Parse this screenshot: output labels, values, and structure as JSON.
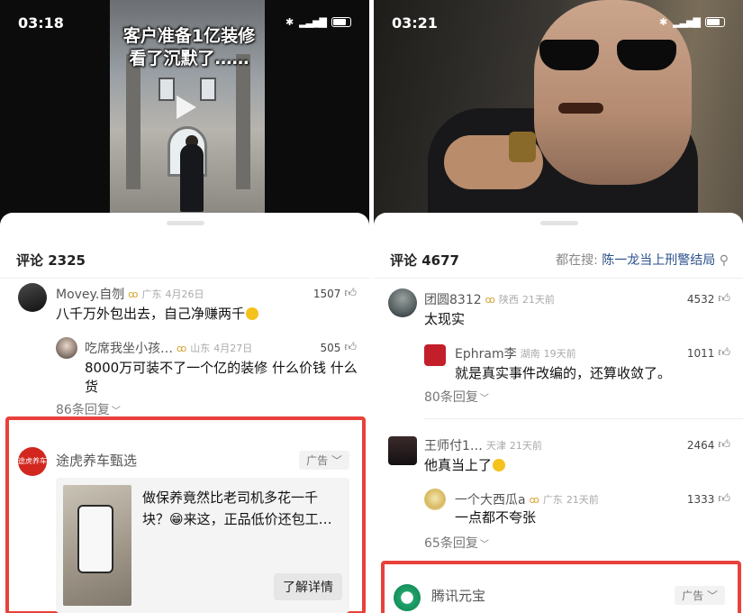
{
  "left": {
    "status_time": "03:18",
    "video_caption_line1": "客户准备1亿装修",
    "video_caption_line2": "看了沉默了……",
    "comment_count": "评论 2325",
    "comments": [
      {
        "name": "Movey.自刎",
        "location": "广东",
        "date": "4月26日",
        "likes": "1507",
        "text": "八千万外包出去，自己净赚两千"
      },
      {
        "name": "吃席我坐小孩…",
        "location": "山东",
        "date": "4月27日",
        "likes": "505",
        "text_line1": "8000万可装不了一个亿的装修 什么价钱 什么",
        "text_line2": "货"
      }
    ],
    "replies_link": "86条回复",
    "ad": {
      "name": "途虎养车甄选",
      "avatar_text": "途虎养车",
      "tag": "广告",
      "text_line1": "做保养竟然比老司机多花一千",
      "text_line2": "块？😁来这，正品低价还包工…",
      "button": "了解详情"
    }
  },
  "right": {
    "status_time": "03:21",
    "comment_count": "评论 4677",
    "search_prefix": "都在搜:",
    "search_term": "陈一龙当上刑警结局",
    "comments": [
      {
        "name": "团圆8312",
        "location": "陕西",
        "date": "21天前",
        "likes": "4532",
        "text": "太现实"
      },
      {
        "name": "Ephram李",
        "location": "湖南",
        "date": "19天前",
        "likes": "1011",
        "text": "就是真实事件改编的，还算收敛了。"
      },
      {
        "name": "王师付1…",
        "location": "天津",
        "date": "21天前",
        "likes": "2464",
        "text": "他真当上了"
      },
      {
        "name": "一个大西瓜a",
        "location": "广东",
        "date": "21天前",
        "likes": "1333",
        "text": "一点都不夸张"
      }
    ],
    "replies_link_1": "80条回复",
    "replies_link_2": "65条回复",
    "ad": {
      "name": "腾讯元宝",
      "tag": "广告"
    }
  },
  "icons": {
    "thumb": "like-thumb-icon",
    "chevron": "chevron-down-icon",
    "bluetooth": "bluetooth-icon",
    "signal": "signal-icon",
    "battery": "battery-icon"
  },
  "colors": {
    "ad_highlight": "#e8413b",
    "search_term": "#2a4f8a",
    "badge_gold": "#d7a22b"
  }
}
